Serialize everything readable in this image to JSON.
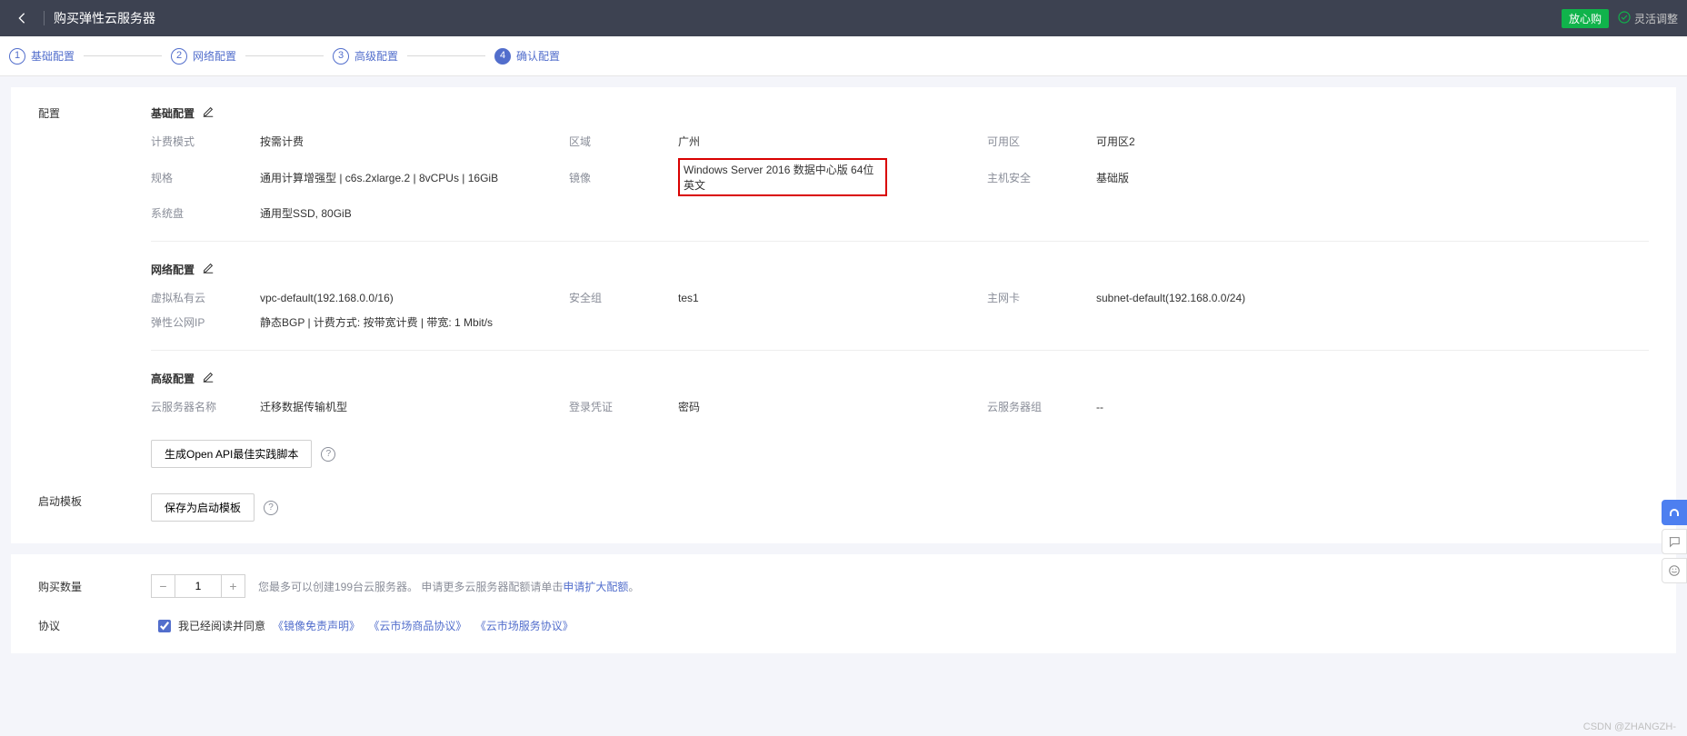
{
  "header": {
    "title": "购买弹性云服务器",
    "safe_buy_label": "放心购",
    "flex_adjust_label": "灵活调整"
  },
  "steps": {
    "s1": {
      "num": "1",
      "label": "基础配置"
    },
    "s2": {
      "num": "2",
      "label": "网络配置"
    },
    "s3": {
      "num": "3",
      "label": "高级配置"
    },
    "s4": {
      "num": "4",
      "label": "确认配置"
    }
  },
  "config_label": "配置",
  "basic": {
    "title": "基础配置",
    "billing_label": "计费模式",
    "billing_value": "按需计费",
    "region_label": "区域",
    "region_value": "广州",
    "az_label": "可用区",
    "az_value": "可用区2",
    "spec_label": "规格",
    "spec_value": "通用计算增强型 | c6s.2xlarge.2 | 8vCPUs | 16GiB",
    "image_label": "镜像",
    "image_value": "Windows Server 2016 数据中心版 64位英文",
    "security_label": "主机安全",
    "security_value": "基础版",
    "sysdisk_label": "系统盘",
    "sysdisk_value": "通用型SSD, 80GiB"
  },
  "network": {
    "title": "网络配置",
    "vpc_label": "虚拟私有云",
    "vpc_value": "vpc-default(192.168.0.0/16)",
    "sg_label": "安全组",
    "sg_value": "tes1",
    "nic_label": "主网卡",
    "nic_value": "subnet-default(192.168.0.0/24)",
    "eip_label": "弹性公网IP",
    "eip_value": "静态BGP | 计费方式: 按带宽计费 | 带宽: 1 Mbit/s"
  },
  "advanced": {
    "title": "高级配置",
    "name_label": "云服务器名称",
    "name_value": "迁移数据传输机型",
    "cred_label": "登录凭证",
    "cred_value": "密码",
    "group_label": "云服务器组",
    "group_value": "--"
  },
  "actions": {
    "gen_api_label": "生成Open API最佳实践脚本",
    "save_tpl_label": "保存为启动模板"
  },
  "launch_tpl_label": "启动模板",
  "purchase": {
    "qty_label": "购买数量",
    "qty_value": "1",
    "hint_prefix": "您最多可以创建199台云服务器。 申请更多云服务器配额请单击",
    "hint_link": "申请扩大配额",
    "hint_suffix": "。"
  },
  "agreement": {
    "label": "协议",
    "prefix": "我已经阅读并同意",
    "l1": "《镜像免责声明》",
    "l2": "《云市场商品协议》",
    "l3": "《云市场服务协议》"
  },
  "watermark": "CSDN @ZHANGZH-"
}
